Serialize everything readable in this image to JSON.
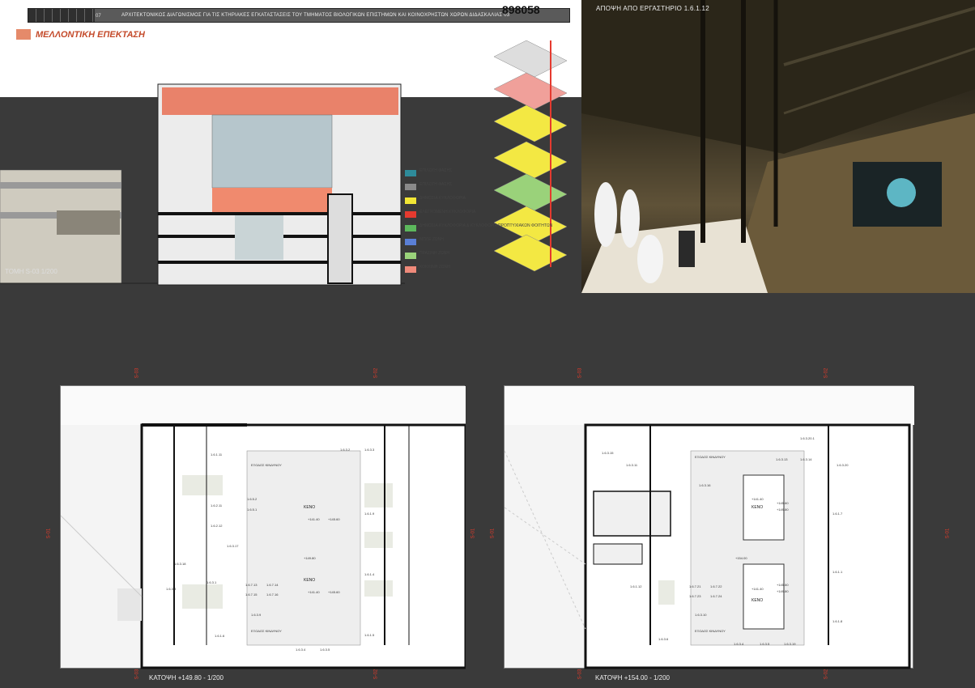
{
  "header": {
    "page_no": "07",
    "subtitle": "ΑΡΧΙΤΕΚΤΟΝΙΚΟΣ ΔΙΑΓΩΝΙΣΜΟΣ ΓΙΑ ΤΙΣ ΚΤΗΡΙΑΚΕΣ ΕΓΚΑΤΑΣΤΑΣΕΙΣ ΤΟΥ ΤΜΗΜΑΤΟΣ ΒΙΟΛΟΓΙΚΩΝ ΕΠΙΣΤΗΜΩΝ ΚΑΙ ΚΟΙΝΟΧΡΗΣΤΩΝ ΧΩΡΩΝ ΔΙΔΑΣΚΑΛΙΑΣ 03",
    "entry_number": "898058"
  },
  "future_extension": {
    "label": "ΜΕΛΛΟΝΤΙΚΗ ΕΠΕΚΤΑΣΗ",
    "color": "#e58a6a"
  },
  "section": {
    "caption": "ΤΟΜΗ S-03 1/200"
  },
  "legend": [
    {
      "label": "ΕΠΙΛΟΓΗ ΦΑΣΗΣ",
      "color": "#2e8b9a"
    },
    {
      "label": "ΕΠΙΛΟΓΗ ΦΑΣΗΣ",
      "color": "#8a8a8a"
    },
    {
      "label": "ΔΗΜΟΣΙΑ ΚΥΚΛΟΦΟΡΙΑ",
      "color": "#f2e635"
    },
    {
      "label": "ΕΛΕΓΧΟΜΕΝΗ ΚΥΚΛΟΦΟΡΙΑ",
      "color": "#e53a2f"
    },
    {
      "label": "ΔΗΜΟΣΙΑ ΚΥΚΛΟΦΟΡΙΑ & ΚΥΚΛΟΦΟΡΙΑ ΠΡΟΠΤΥΧΙΑΚΩΝ ΦΟΙΤΗΤΩΝ",
      "color": "#5cb85c"
    },
    {
      "label": "ΜΠΛΕ ΖΩΝΗ",
      "color": "#5a7fd6"
    },
    {
      "label": "ΠΡΑΣΙΝΗ ΖΩΝΗ",
      "color": "#9ad27a"
    },
    {
      "label": "ΚΟΚΚΙΝΗ ΖΩΝΗ",
      "color": "#ef8a7a"
    }
  ],
  "render": {
    "title": "ΑΠΟΨΗ ΑΠΟ ΕΡΓΑΣΤΗΡΙΟ 1.6.1.12"
  },
  "plans": [
    {
      "caption": "ΚΑΤΟΨΗ +149.80 - 1/200",
      "void_label": "ΚΕΝΟ",
      "levels": [
        "+141.40",
        "+145.60",
        "+149.80",
        "+141.40",
        "+145.60"
      ],
      "exits": [
        "ΕΞΟΔΟΣ ΚΙΝΔΥΝΟΥ",
        "ΕΞΟΔΟΣ ΚΙΝΔΥΝΟΥ"
      ],
      "rooms": [
        "1.6.1.11",
        "1.6.2.11",
        "1.6.2.12",
        "1.6.3.17",
        "1.6.3.18",
        "1.6.3.1",
        "1.6.3.8",
        "1.6.1.6",
        "1.6.3.4",
        "1.6.3.5",
        "1.6.3.9",
        "1.6.5.2",
        "1.6.5.1",
        "1.6.1.9",
        "1.6.1.4",
        "1.6.1.5",
        "1.6.3.2",
        "1.6.3.3",
        "1.6.7.13",
        "1.6.7.14",
        "1.6.7.15",
        "1.6.7.16"
      ],
      "section_marks": [
        "S-03",
        "S-02",
        "S-01",
        "S-01",
        "S-03",
        "S-02"
      ]
    },
    {
      "caption": "ΚΑΤΟΨΗ +154.00 - 1/200",
      "void_label": "ΚΕΝΟ",
      "levels": [
        "+141.40",
        "+145.60",
        "+149.80",
        "+154.00",
        "+141.40",
        "+145.60",
        "+149.80"
      ],
      "exits": [
        "ΕΞΟΔΟΣ ΚΙΝΔΥΝΟΥ",
        "ΕΞΟΔΟΣ ΚΙΝΔΥΝΟΥ"
      ],
      "rooms": [
        "1.6.3.15",
        "1.6.3.11",
        "1.6.3.16",
        "1.6.3.13",
        "1.6.3.14",
        "1.6.3.20",
        "1.6.1.7",
        "1.6.1.1",
        "1.6.1.12",
        "1.6.1.8",
        "1.6.3.4",
        "1.6.3.5",
        "1.6.3.19",
        "1.6.3.6",
        "1.6.3.10",
        "1.6.7.21",
        "1.6.7.22",
        "1.6.7.23",
        "1.6.7.24",
        "1.6.3.20.1"
      ],
      "section_marks": [
        "S-03",
        "S-02",
        "S-01",
        "S-01",
        "S-03",
        "S-02"
      ]
    }
  ]
}
